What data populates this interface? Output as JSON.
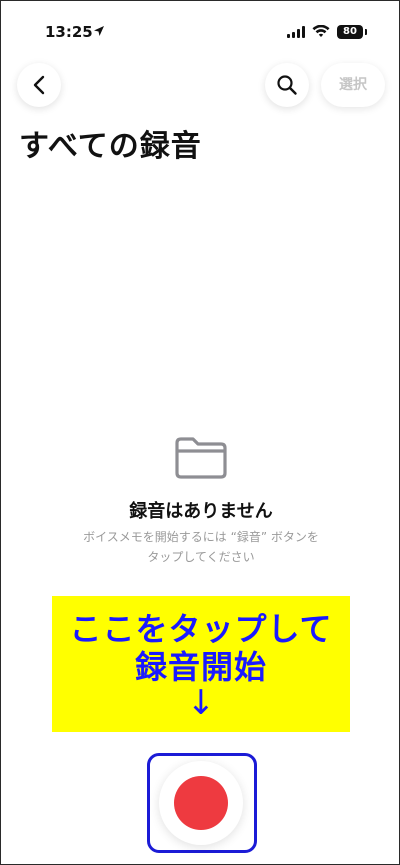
{
  "status_bar": {
    "time": "13:25",
    "battery": "80"
  },
  "nav": {
    "select_label": "選択"
  },
  "page": {
    "title": "すべての録音"
  },
  "empty_state": {
    "title": "録音はありません",
    "hint": "ボイスメモを開始するには “録音” ボタンを\nタップしてください"
  },
  "annotation": {
    "line1": "ここをタップして",
    "line2": "録音開始",
    "arrow": "↓"
  },
  "colors": {
    "record_red": "#ee3a40",
    "annotation_yellow": "#ffff00",
    "annotation_blue": "#1a1aff",
    "highlight_border": "#1b1bd6"
  }
}
